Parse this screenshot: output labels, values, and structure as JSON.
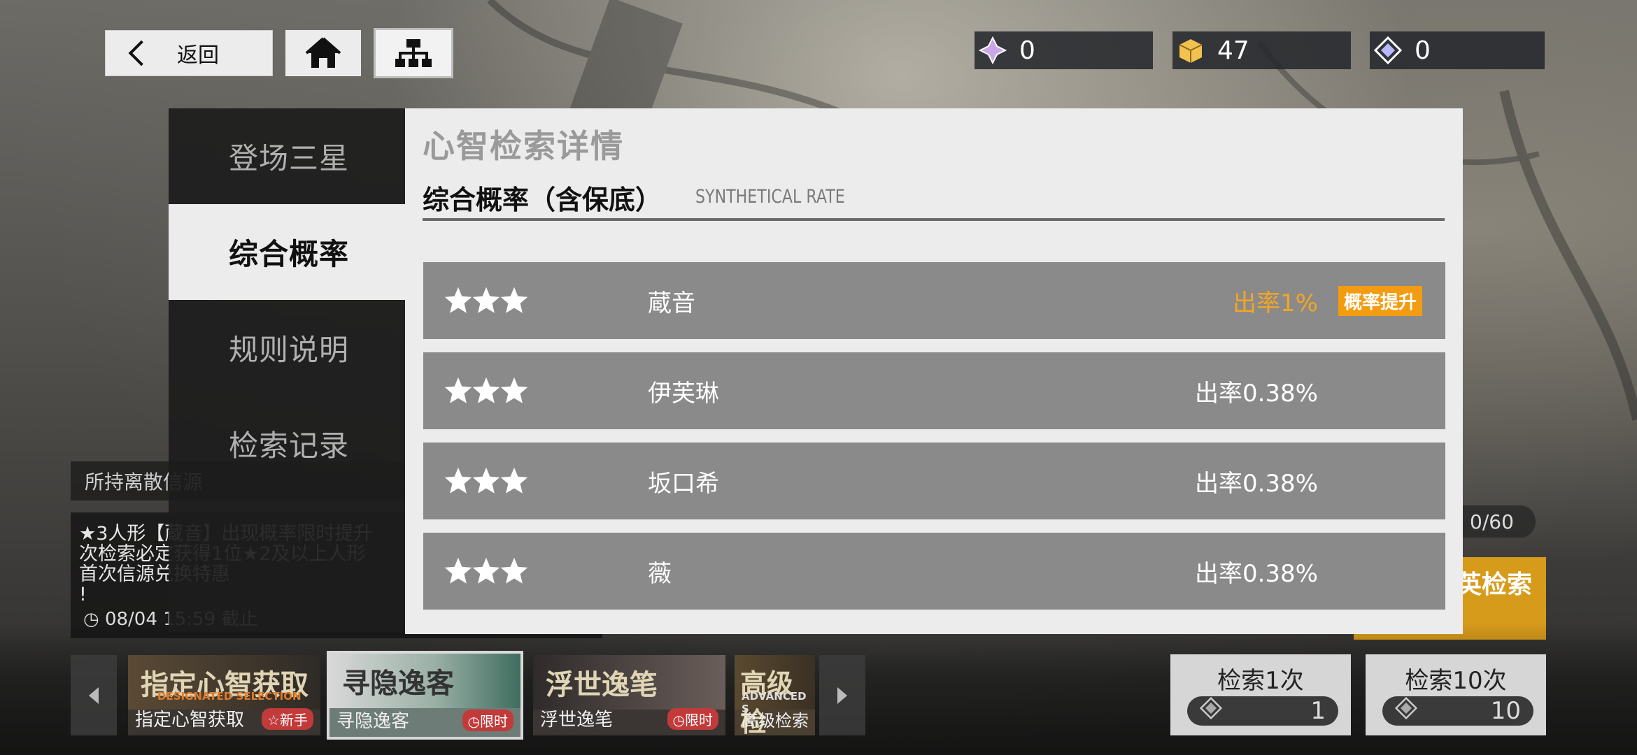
{
  "top_bar": {
    "back_label": "返回",
    "home_icon": "home-icon",
    "hierarchy_icon": "hierarchy-icon",
    "resources": [
      {
        "icon": "crystal-icon",
        "value": "0",
        "color": "#c9a6e6"
      },
      {
        "icon": "supply-box-icon",
        "value": "47",
        "color": "#f2c14e"
      },
      {
        "icon": "diamond-token-icon",
        "value": "0",
        "color": "#c7c7ff"
      }
    ]
  },
  "nav": {
    "items": [
      {
        "label": "登场三星",
        "active": false
      },
      {
        "label": "综合概率",
        "active": true
      },
      {
        "label": "规则说明",
        "active": false
      },
      {
        "label": "检索记录",
        "active": false
      }
    ]
  },
  "panel": {
    "title": "心智检索详情",
    "subtitle": "综合概率（含保底）",
    "subtitle_en": "SYNTHETICAL RATE",
    "rows": [
      {
        "stars": 3,
        "name": "蔵音",
        "rate": "出率1%",
        "highlight": true,
        "badge": "概率提升"
      },
      {
        "stars": 3,
        "name": "伊芙琳",
        "rate": "出率0.38%",
        "highlight": false,
        "badge": ""
      },
      {
        "stars": 3,
        "name": "坂口希",
        "rate": "出率0.38%",
        "highlight": false,
        "badge": ""
      },
      {
        "stars": 3,
        "name": "薇",
        "rate": "出率0.38%",
        "highlight": false,
        "badge": ""
      }
    ]
  },
  "background_info": {
    "hold_text": "所持离散信源",
    "notice_lines": [
      "★3人形【蔵音】出现概率限时提升",
      "次检索必定获得1位★2及以上人形",
      "首次信源兑换特惠",
      "!"
    ],
    "time": "08/04 15:59 截止"
  },
  "banners": [
    {
      "title": "指定心智获取",
      "title_en": "DESIGNATED SELECTION",
      "label": "指定心智获取",
      "tag": "☆新手"
    },
    {
      "title": "寻隐逸客",
      "title_en": "",
      "label": "寻隐逸客",
      "tag": "◷限时"
    },
    {
      "title": "浮世逸笔",
      "title_en": "",
      "label": "浮世逸笔",
      "tag": "◷限时"
    },
    {
      "title": "高级检",
      "title_en": "ADVANCED S",
      "label": "高级检索",
      "tag": ""
    }
  ],
  "actions": {
    "elite_label": "英检索",
    "elite_count": "0/60",
    "pull_once": {
      "label": "检索1次",
      "cost": "1"
    },
    "pull_ten": {
      "label": "检索10次",
      "cost": "10"
    }
  }
}
